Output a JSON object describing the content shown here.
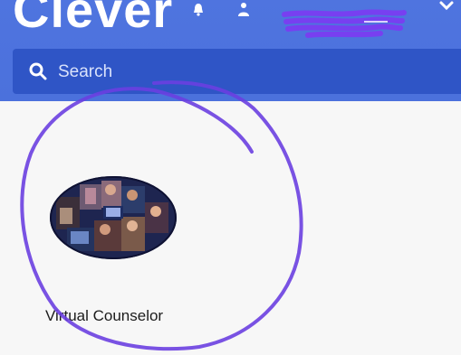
{
  "header": {
    "logo_text": "Clever",
    "brand_color": "#4f74df",
    "search_bar_color": "#2f55c6",
    "icons": [
      "bell-icon",
      "user-icon",
      "chevron-down-icon"
    ]
  },
  "search": {
    "placeholder": "Search",
    "icon": "search-icon"
  },
  "apps": [
    {
      "label": "Virtual Counselor",
      "icon": "app-collage-icon"
    }
  ],
  "annotation": {
    "color": "#6a3fe0"
  },
  "redaction": {
    "color": "#7b3df2"
  }
}
